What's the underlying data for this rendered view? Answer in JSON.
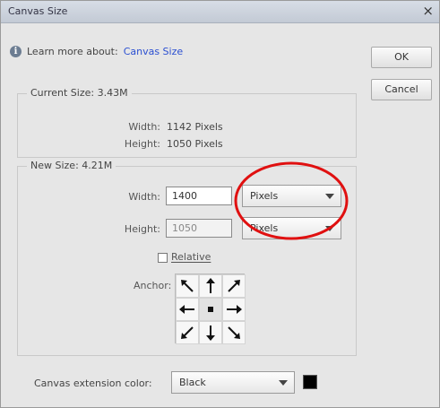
{
  "window": {
    "title": "Canvas Size",
    "close_glyph": "×"
  },
  "info": {
    "learn_text": "Learn more about:",
    "learn_link": "Canvas Size"
  },
  "buttons": {
    "ok": "OK",
    "cancel": "Cancel"
  },
  "current_size": {
    "legend": "Current Size: 3.43M",
    "width_label": "Width:",
    "width_value": "1142 Pixels",
    "height_label": "Height:",
    "height_value": "1050 Pixels"
  },
  "new_size": {
    "legend": "New Size: 4.21M",
    "width_label": "Width:",
    "width_value": "1400",
    "width_unit": "Pixels",
    "height_label": "Height:",
    "height_value": "1050",
    "height_unit": "Pixels",
    "relative_label": "Relative",
    "relative_checked": false,
    "anchor_label": "Anchor:"
  },
  "extension": {
    "label": "Canvas extension color:",
    "value": "Black",
    "swatch_color": "#000000"
  },
  "annotation": {
    "circle_color": "#e01010"
  }
}
